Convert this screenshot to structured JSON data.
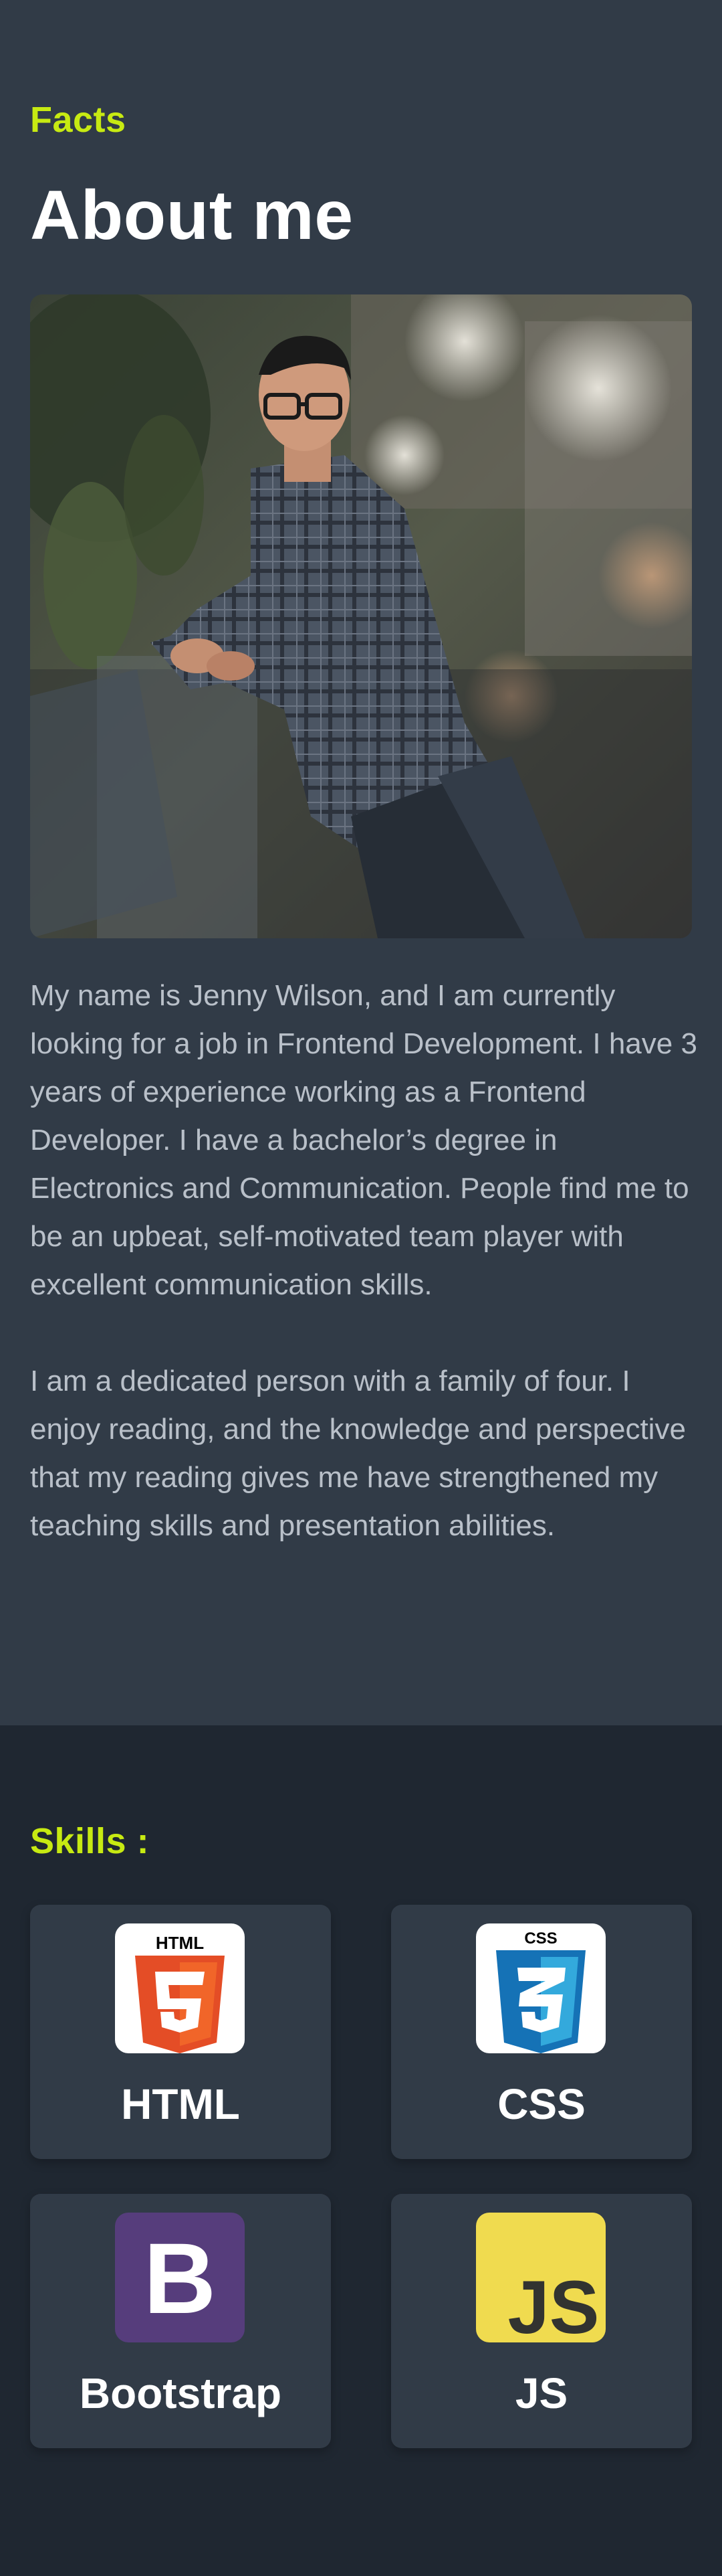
{
  "about": {
    "eyebrow": "Facts",
    "title": "About me",
    "paragraphs": [
      "My name is Jenny Wilson, and I am currently looking for a job in Frontend Development. I have 3 years of experience working as a Frontend Developer. I have a bachelor’s degree in Electronics and Communication. People find me to be an upbeat, self-motivated team player with excellent communication skills.",
      "I am a dedicated person with a family of four. I enjoy reading, and the knowledge and perspective that my reading gives me have strengthened my teaching skills and presentation abilities."
    ]
  },
  "skills": {
    "heading": "Skills :",
    "items": [
      {
        "label": "HTML",
        "icon": "html5-icon",
        "logo_text": "HTML",
        "color": "#e44d26"
      },
      {
        "label": "CSS",
        "icon": "css3-icon",
        "logo_text": "CSS",
        "color": "#2965f1"
      },
      {
        "label": "Bootstrap",
        "icon": "bootstrap-icon",
        "logo_text": "B",
        "color": "#563d7c"
      },
      {
        "label": "JS",
        "icon": "javascript-icon",
        "logo_text": "JS",
        "color": "#f0db4f"
      }
    ]
  },
  "colors": {
    "accent": "#c7ea12",
    "about_bg": "#313b47",
    "skills_bg": "#1f2731",
    "card_bg": "#313b47",
    "body_text": "#b9c0c9"
  }
}
